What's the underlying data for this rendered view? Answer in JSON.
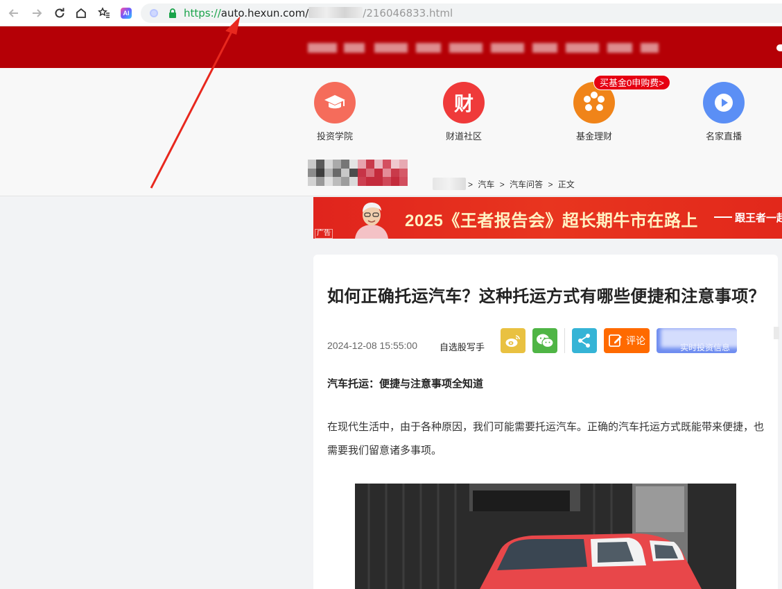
{
  "browser": {
    "url_scheme": "https://",
    "url_domain": "auto.hexun.com/",
    "url_path": "/216046833.html",
    "ai_badge": "AI"
  },
  "apps": [
    {
      "label": "投资学院",
      "color": "#f56c5b"
    },
    {
      "label": "财道社区",
      "color": "#ef3a3a",
      "glyph": "财"
    },
    {
      "label": "基金理财",
      "color": "#f08419"
    },
    {
      "label": "名家直播",
      "color": "#5b8ff5"
    }
  ],
  "promo_badge": "买基金0申购费>",
  "breadcrumb": {
    "items": [
      "汽车",
      "汽车问答",
      "正文"
    ],
    "sep": ">"
  },
  "ad_banner": {
    "headline": "2025《王者报告会》超长期牛市在路上",
    "tail": "跟王者一起",
    "tag": "广告"
  },
  "article": {
    "title": "如何正确托运汽车？这种托运方式有哪些便捷和注意事项？",
    "date": "2024-12-08 15:55:00",
    "source": "自选股写手",
    "comment_label": "评论",
    "info_label": "实时投资信息",
    "subhead": "汽车托运：便捷与注意事项全知道",
    "paragraph": "在现代生活中，由于各种原因，我们可能需要托运汽车。正确的汽车托运方式既能带来便捷，也需要我们留意诸多事项。"
  },
  "colors": {
    "header_red": "#b50006",
    "weibo": "#e9c141",
    "wechat": "#4fb545",
    "share": "#35b4d6",
    "comment": "#ff6a00",
    "info": "#6f8df0",
    "annotation_arrow": "#e8281e"
  }
}
